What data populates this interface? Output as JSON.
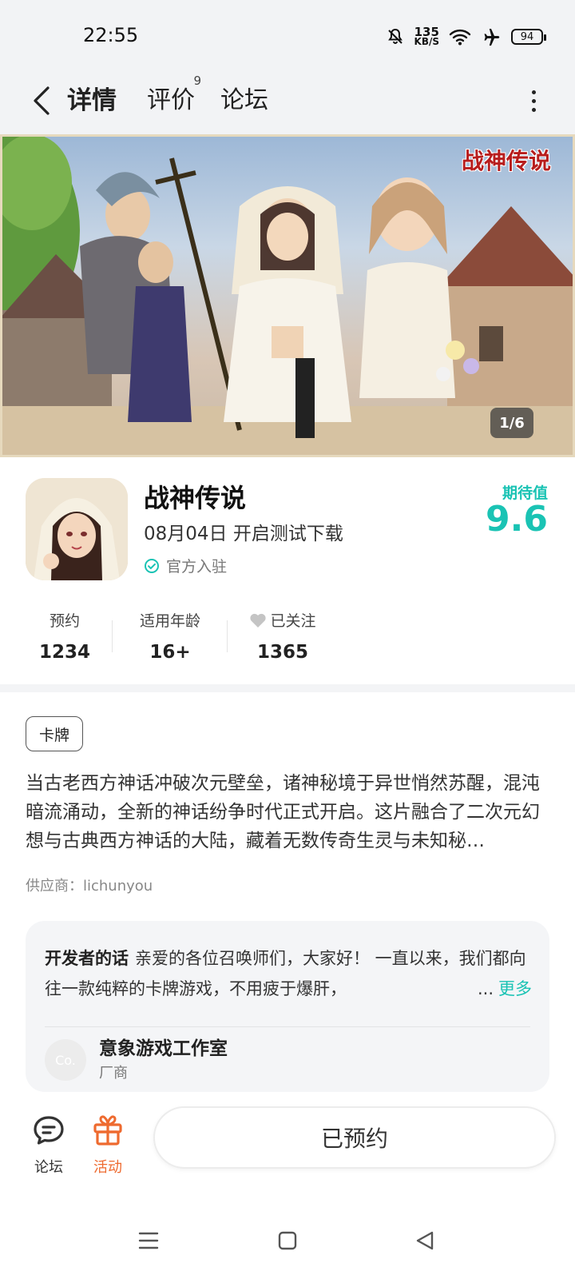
{
  "status_bar": {
    "time": "22:55",
    "net_speed_value": "135",
    "net_speed_unit": "KB/S",
    "battery": "94",
    "icons": [
      "bell-muted-icon",
      "wifi-icon",
      "airplane-icon",
      "battery-icon"
    ]
  },
  "nav": {
    "tabs": [
      {
        "label": "详情",
        "active": true
      },
      {
        "label": "评价",
        "badge": "9"
      },
      {
        "label": "论坛"
      }
    ],
    "accent_color": "#1ad1c1"
  },
  "banner": {
    "logo_text": "战神传说",
    "counter": "1/6"
  },
  "app": {
    "title": "战神传说",
    "date_text": "08月04日 开启测试下载",
    "official_label": "官方入驻",
    "expect_label": "期待值",
    "expect_value": "9.6"
  },
  "stats": [
    {
      "label": "预约",
      "value": "1234"
    },
    {
      "label": "适用年龄",
      "value": "16+"
    },
    {
      "label": "已关注",
      "value": "1365"
    }
  ],
  "tag": "卡牌",
  "description": "当古老西方神话冲破次元壁垒，诸神秘境于异世悄然苏醒，混沌暗流涌动，全新的神话纷争时代正式开启。这片融合了二次元幻想与古典西方神话的大陆，藏着无数传奇生灵与未知秘…",
  "supplier": "供应商：lichunyou",
  "developer": {
    "heading": "开发者的话",
    "text": "亲爱的各位召唤师们，大家好！ 一直以来，我们都向往一款纯粹的卡牌游戏，不用疲于爆肝，",
    "ellipsis": "...",
    "more_label": "更多",
    "avatar_text": "Co.",
    "studio_name": "意象游戏工作室",
    "studio_role": "厂商"
  },
  "bottom_bar": {
    "forum_label": "论坛",
    "activity_label": "活动",
    "reserve_label": "已预约",
    "activity_color": "#ee6a2f"
  }
}
